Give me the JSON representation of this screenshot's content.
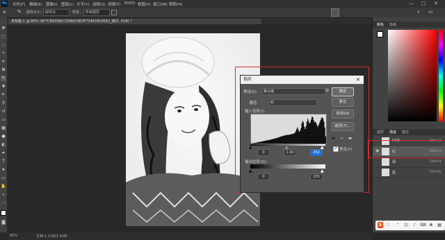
{
  "menubar": {
    "logo": "Ps",
    "items": [
      "文件(F)",
      "编辑(E)",
      "图像(I)",
      "图层(L)",
      "文字(Y)",
      "选择(S)",
      "滤镜(T)",
      "3D(D)",
      "视图(V)",
      "窗口(W)",
      "帮助(H)"
    ],
    "window_controls": [
      "—",
      "□",
      "✕"
    ]
  },
  "options": {
    "sample_size": "取样大小：",
    "sample_value": "取样点",
    "sample_layer": "样本：",
    "sample_layer_value": "所有图层"
  },
  "document": {
    "tab_title": "未标题-1 @ 80% (6F7C8635BCC5060C4E3F724678195E2_拷贝, 红/8) *",
    "zoom": "80%",
    "status": "文档:1.12M/1.60M"
  },
  "levels_dialog": {
    "title": "色阶",
    "preset_label": "预设(E):",
    "preset_value": "默认值",
    "channel_label": "通道:",
    "channel_value": "红",
    "input_label": "输入色阶(I):",
    "input_values": [
      "0",
      "1.00",
      "252"
    ],
    "output_label": "输出色阶(O):",
    "output_values": [
      "0",
      "255"
    ],
    "buttons": {
      "ok": "确定",
      "reset": "复位",
      "auto": "自动(A)",
      "options": "选项(T)..."
    },
    "preview_label": "预览(P)",
    "preview_checked": true,
    "histogram": [
      1,
      1,
      1,
      2,
      2,
      2,
      3,
      3,
      4,
      4,
      5,
      5,
      6,
      6,
      7,
      7,
      8,
      8,
      9,
      9,
      10,
      10,
      11,
      11,
      12,
      12,
      13,
      14,
      14,
      15,
      16,
      16,
      17,
      18,
      19,
      20,
      20,
      21,
      22,
      22,
      23,
      23,
      24,
      24,
      24,
      25,
      25,
      26,
      26,
      27,
      28,
      30,
      34,
      40,
      44,
      38,
      32,
      35,
      42,
      55,
      62,
      58,
      46,
      40,
      48,
      60,
      68,
      62,
      55,
      58,
      66,
      74,
      72,
      64,
      58,
      60,
      56,
      50,
      46,
      52,
      58,
      64,
      70,
      72,
      68,
      60,
      44,
      20
    ]
  },
  "panels": {
    "color_tabs": [
      "颜色",
      "色板"
    ],
    "channel_tabs": [
      "图层",
      "通道",
      "路径"
    ],
    "channels": [
      {
        "name": "RGB",
        "key": "Ctrl+2"
      },
      {
        "name": "红",
        "key": "Ctrl+3"
      },
      {
        "name": "绿",
        "key": "Ctrl+4"
      },
      {
        "name": "蓝",
        "key": "Ctrl+5"
      }
    ],
    "tray_logo": "S"
  },
  "colors": {
    "accent_red": "#d32d2d",
    "hue_top": "#ff0000",
    "active_blue": "#1473e6"
  }
}
